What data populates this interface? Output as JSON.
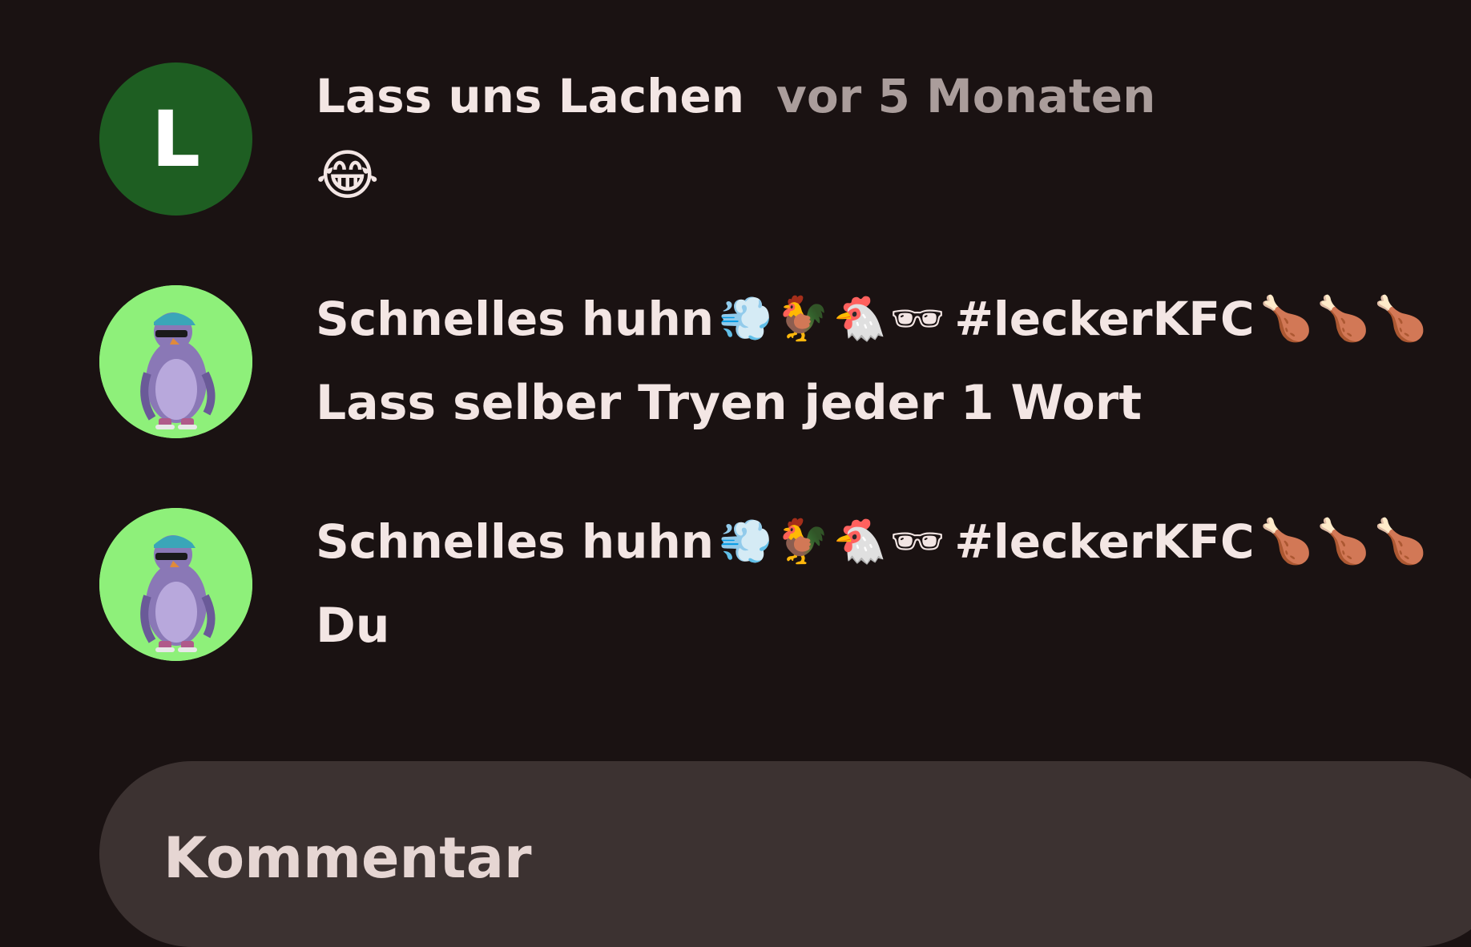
{
  "comments": [
    {
      "avatar_letter": "L",
      "author": "Lass uns Lachen",
      "time": "vor 5 Monaten",
      "text": "😂"
    },
    {
      "author": "Schnelles huhn",
      "author_emojis": "💨🐓🐔🕶",
      "author_tag": "#leckerKFC",
      "author_tag_emojis": "🍗🍗🍗",
      "text": "Lass selber Tryen jeder 1 Wort"
    },
    {
      "author": "Schnelles huhn",
      "author_emojis": "💨🐓🐔🕶",
      "author_tag": "#leckerKFC",
      "author_tag_emojis": "🍗🍗🍗",
      "text": "Du"
    }
  ],
  "comment_input": {
    "placeholder": "Kommentar"
  },
  "colors": {
    "background": "#1a1212",
    "avatar_letter_bg": "#1e5e22",
    "avatar_image_bg": "#8ef07a",
    "input_bg": "#3c3231",
    "muted_text": "#aa9d9b"
  }
}
